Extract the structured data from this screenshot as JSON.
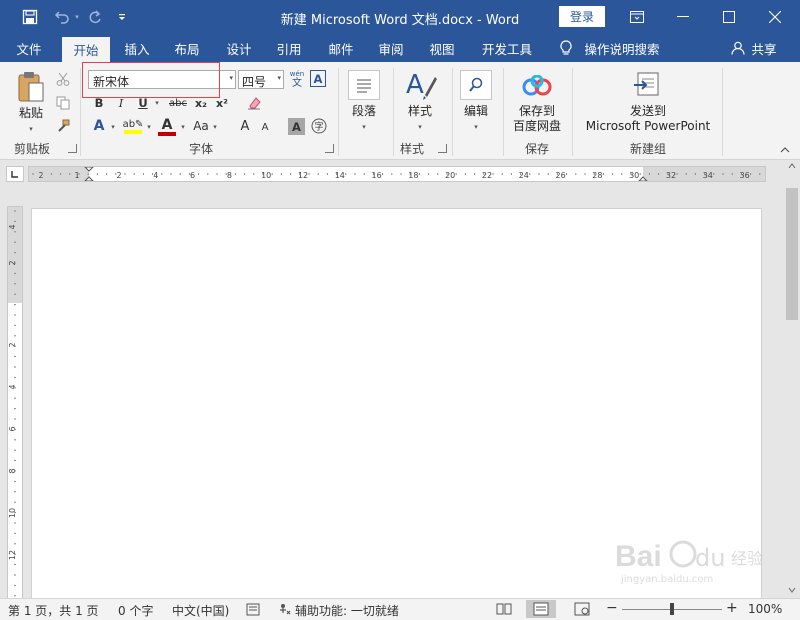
{
  "window": {
    "title": "新建 Microsoft Word 文档.docx  -  Word",
    "login_label": "登录"
  },
  "tabs": [
    "文件",
    "开始",
    "插入",
    "布局",
    "设计",
    "引用",
    "邮件",
    "审阅",
    "视图",
    "开发工具"
  ],
  "active_tab": "开始",
  "tell_me": "操作说明搜索",
  "share": "共享",
  "ribbon": {
    "clipboard": {
      "paste_label": "粘贴",
      "group_label": "剪贴板"
    },
    "font": {
      "font_name": "新宋体",
      "font_size": "四号",
      "bold": "B",
      "italic": "I",
      "underline": "U",
      "strikethrough": "abc",
      "subscript": "x₂",
      "superscript": "x²",
      "change_case": "Aa",
      "grow_font": "A",
      "shrink_font": "A",
      "phonetic_top": "wén",
      "phonetic_bottom": "文",
      "group_label": "字体",
      "font_color": "#c00000",
      "highlight_color": "#ffff00"
    },
    "paragraph": {
      "label": "段落"
    },
    "styles": {
      "label": "样式",
      "group_label": "样式"
    },
    "editing": {
      "label": "编辑"
    },
    "save": {
      "label_line1": "保存到",
      "label_line2": "百度网盘",
      "group_label": "保存"
    },
    "new_group": {
      "label_line1": "发送到",
      "label_line2": "Microsoft PowerPoint",
      "group_label": "新建组"
    }
  },
  "ruler": {
    "h_labels": [
      "2",
      "1",
      "2",
      "4",
      "6",
      "8",
      "10",
      "12",
      "14",
      "16",
      "18",
      "20",
      "22",
      "24",
      "26",
      "28",
      "30",
      "32",
      "34",
      "36"
    ],
    "v_labels": [
      "4",
      "2",
      "2",
      "4",
      "6",
      "8",
      "10",
      "12"
    ]
  },
  "status": {
    "page": "第 1 页，共 1 页",
    "words": "0 个字",
    "language": "中文(中国)",
    "accessibility": "辅助功能: 一切就绪",
    "zoom": "100%",
    "zoom_level": 100
  },
  "watermark_text": "Baidu 经验",
  "watermark_url": "jingyan.baidu.com",
  "colors": {
    "title_bar": "#2b579a",
    "ribbon_bg": "#f3f3f3",
    "highlight_box": "#e0444b"
  }
}
